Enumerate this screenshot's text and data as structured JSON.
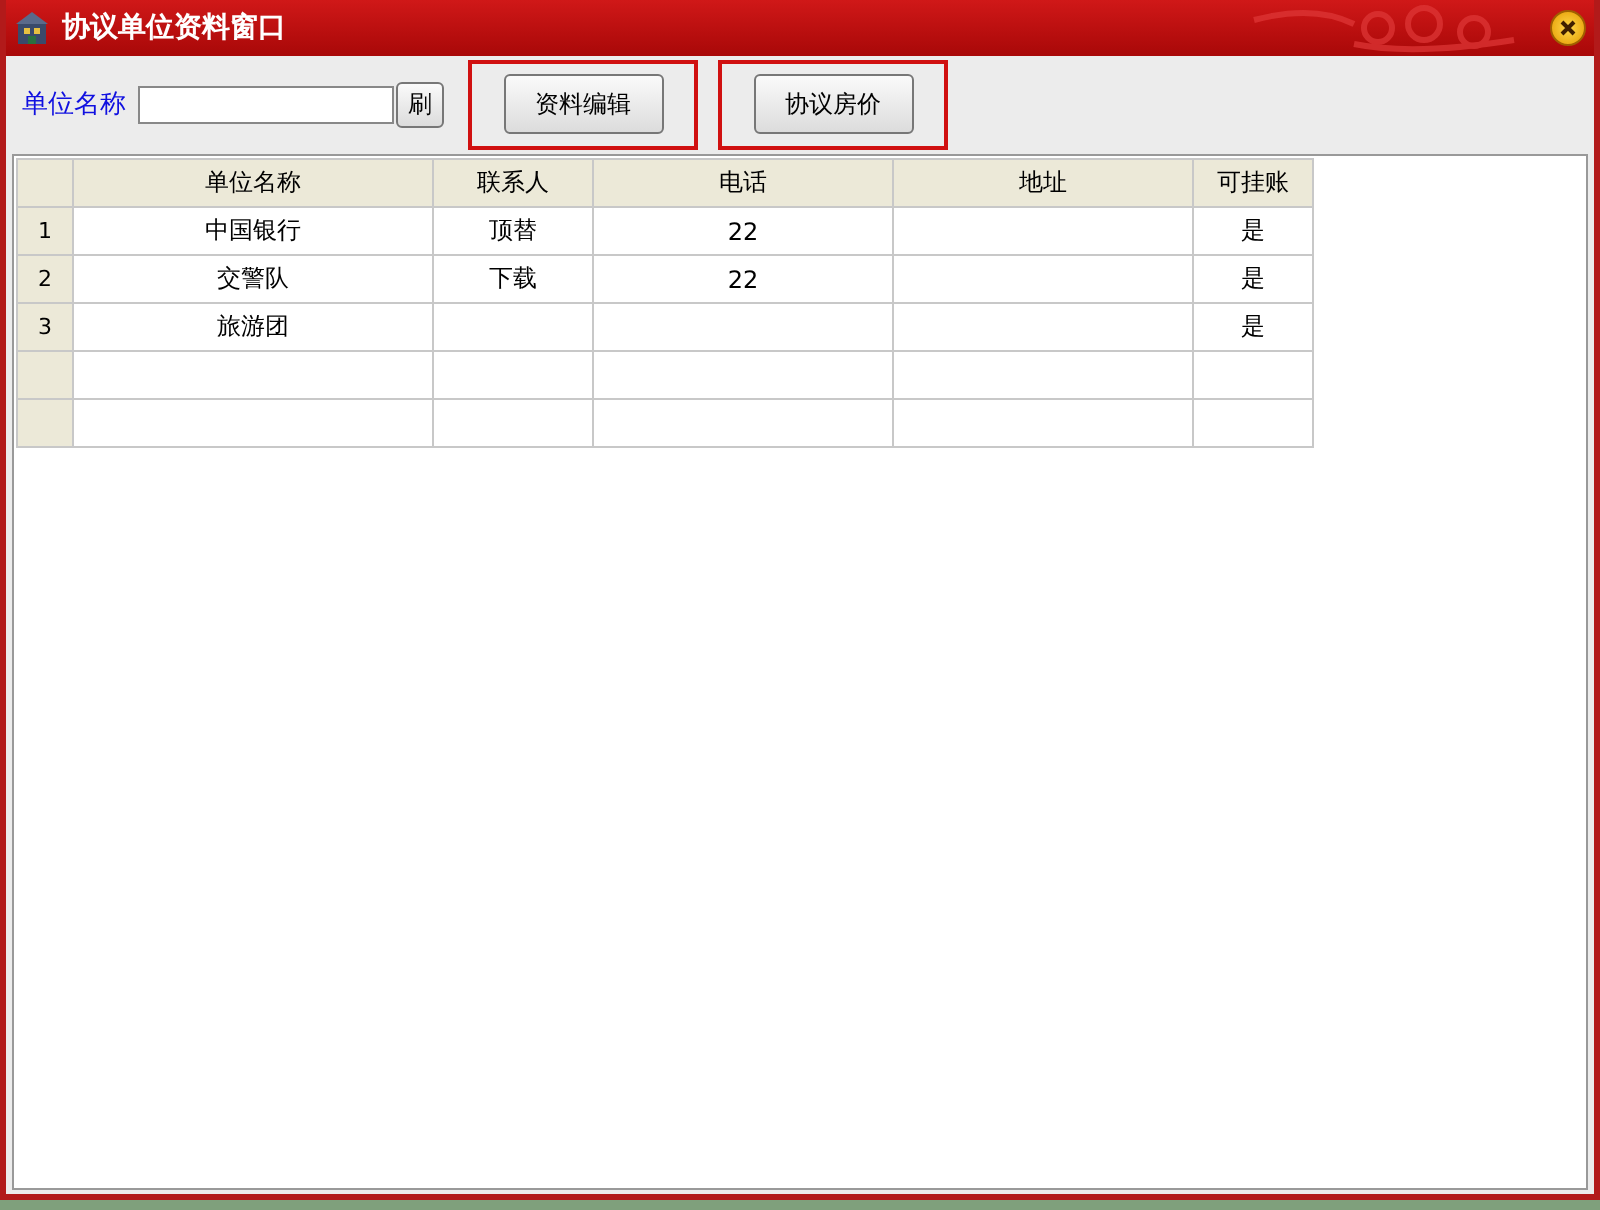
{
  "window": {
    "title": "协议单位资料窗口"
  },
  "search": {
    "label": "单位名称",
    "refresh": "刷"
  },
  "buttons": [
    {
      "label": "资料编辑",
      "highlighted": true
    },
    {
      "label": "协议房价",
      "highlighted": true
    }
  ],
  "table": {
    "columns": [
      "单位名称",
      "联系人",
      "电话",
      "地址",
      "可挂账"
    ],
    "rows": [
      {
        "number": "1",
        "cells": [
          "中国银行",
          "顶替",
          "22",
          "",
          "是"
        ]
      },
      {
        "number": "2",
        "cells": [
          "交警队",
          "下载",
          "22",
          "",
          "是"
        ]
      },
      {
        "number": "3",
        "cells": [
          "旅游团",
          "",
          "",
          "",
          "是"
        ]
      }
    ]
  }
}
